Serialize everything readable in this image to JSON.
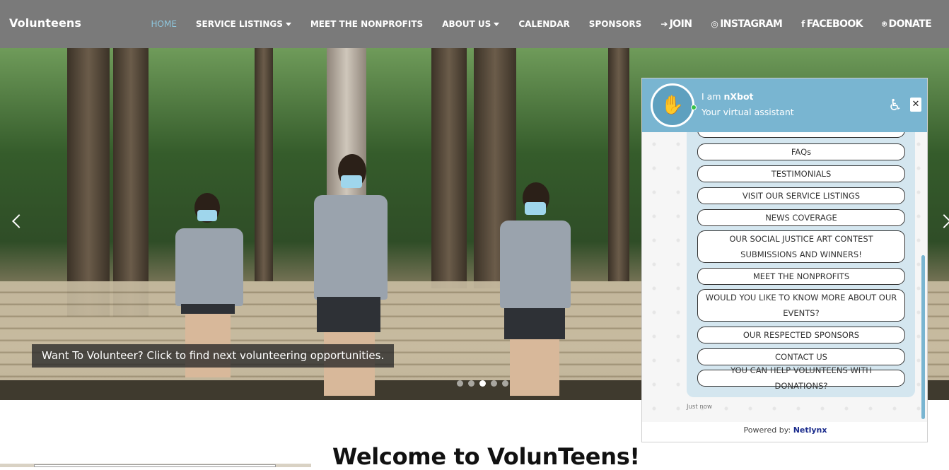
{
  "brand": "Volunteens",
  "nav": [
    {
      "label": "HOME",
      "active": true
    },
    {
      "label": "SERVICE LISTINGS",
      "dropdown": true
    },
    {
      "label": "MEET THE NONPROFITS"
    },
    {
      "label": "ABOUT US",
      "dropdown": true
    },
    {
      "label": "CALENDAR"
    },
    {
      "label": "SPONSORS"
    },
    {
      "label": "JOIN",
      "icon": "sign-in-icon"
    },
    {
      "label": "INSTAGRAM",
      "icon": "instagram-icon"
    },
    {
      "label": "FACEBOOK",
      "icon": "facebook-icon"
    },
    {
      "label": "DONATE",
      "icon": "donate-icon"
    }
  ],
  "hero": {
    "caption": "Want To Volunteer? Click to find next volunteering opportunities.",
    "slide_count": 5,
    "active_slide": 3
  },
  "welcome_title": "Welcome to VolunTeens!",
  "chat": {
    "bot_intro": "I am",
    "bot_name": "nXbot",
    "bot_subtitle": "Your virtual assistant",
    "close_label": "✕",
    "options": [
      "FAQs",
      "TESTIMONIALS",
      "VISIT OUR SERVICE LISTINGS",
      "NEWS COVERAGE",
      "OUR SOCIAL JUSTICE ART CONTEST SUBMISSIONS AND WINNERS!",
      "MEET THE NONPROFITS",
      "WOULD YOU LIKE TO KNOW MORE ABOUT OUR EVENTS?",
      "OUR RESPECTED SPONSORS",
      "CONTACT US",
      "YOU CAN HELP VOLUNTEENS WITH DONATIONS?"
    ],
    "timestamp": "Just now",
    "powered_by_label": "Powered by:",
    "powered_by_brand": "Netlynx"
  },
  "colors": {
    "navbar": "#7a7a7a",
    "nav_active": "#8ec5dc",
    "chat_header": "#79b5d1",
    "chat_panel": "#d4e6ef",
    "powered_brand": "#1a2b8c"
  }
}
